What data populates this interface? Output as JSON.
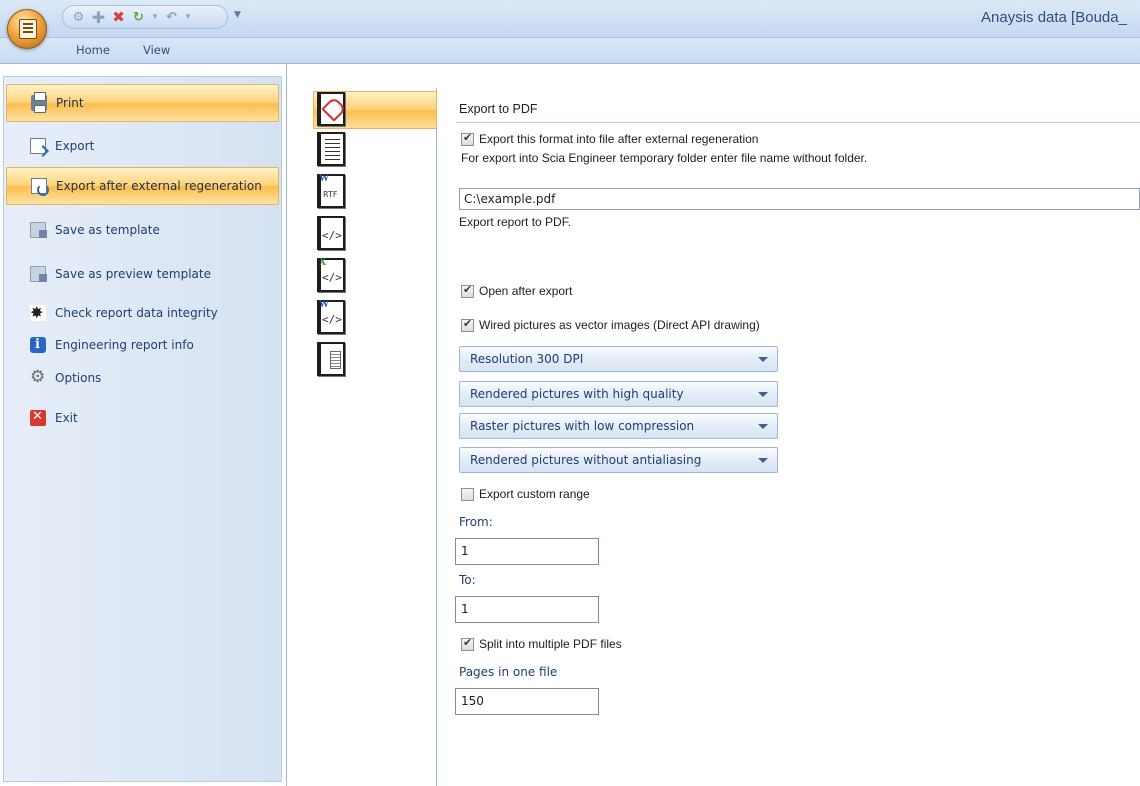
{
  "window": {
    "title": "Anaysis data [Bouda_"
  },
  "ribbon": {
    "tabs": [
      "Home",
      "View"
    ]
  },
  "menu": {
    "items": [
      {
        "label": "Print",
        "icon": "printer-icon",
        "active": true
      },
      {
        "label": "Export",
        "icon": "export-icon",
        "active": false
      },
      {
        "label": "Export after external regeneration",
        "icon": "regeneration-icon",
        "active": true
      },
      {
        "label": "Save as template",
        "icon": "template-icon",
        "active": false
      },
      {
        "label": "Save as preview template",
        "icon": "preview-template-icon",
        "active": false
      },
      {
        "label": "Check report data integrity",
        "icon": "integrity-check-icon",
        "active": false
      },
      {
        "label": "Engineering report info",
        "icon": "info-icon",
        "active": false
      },
      {
        "label": "Options",
        "icon": "gear-icon",
        "active": false
      },
      {
        "label": "Exit",
        "icon": "exit-icon",
        "active": false
      }
    ]
  },
  "formats": {
    "selected": "pdf",
    "items": [
      {
        "id": "pdf",
        "icon": "pdf-icon"
      },
      {
        "id": "txt",
        "icon": "text-document-icon"
      },
      {
        "id": "rtf",
        "icon": "rtf-icon",
        "label": "RTF"
      },
      {
        "id": "html",
        "icon": "html-icon",
        "label": "</>"
      },
      {
        "id": "xml-excel",
        "icon": "excel-xml-icon",
        "label": "</>"
      },
      {
        "id": "xml-word",
        "icon": "word-xml-icon",
        "label": "</>"
      },
      {
        "id": "image",
        "icon": "image-export-icon"
      }
    ]
  },
  "settings": {
    "heading": "Export to PDF",
    "export_after_regen": {
      "label": "Export this format into file after external regeneration",
      "checked": true
    },
    "folder_note": "For export into Scia Engineer temporary folder enter file name without folder.",
    "file_path": "C:\\example.pdf",
    "path_caption": "Export report to PDF.",
    "open_after_export": {
      "label": "Open after export",
      "checked": true
    },
    "vector_images": {
      "label": "Wired pictures as vector images (Direct API drawing)",
      "checked": true
    },
    "resolution": "Resolution 300 DPI",
    "render_quality": "Rendered pictures with high quality",
    "raster_compression": "Raster pictures with low compression",
    "antialiasing": "Rendered pictures without antialiasing",
    "custom_range": {
      "label": "Export custom range",
      "checked": false
    },
    "from_label": "From:",
    "from_value": "1",
    "to_label": "To:",
    "to_value": "1",
    "split": {
      "label": "Split into multiple PDF files",
      "checked": true
    },
    "pages_label": "Pages in one file",
    "pages_value": "150"
  },
  "colors": {
    "accent_active": "#fcbe4a",
    "ribbon_blue": "#c8dbf0",
    "menu_text": "#1f3f6f"
  }
}
